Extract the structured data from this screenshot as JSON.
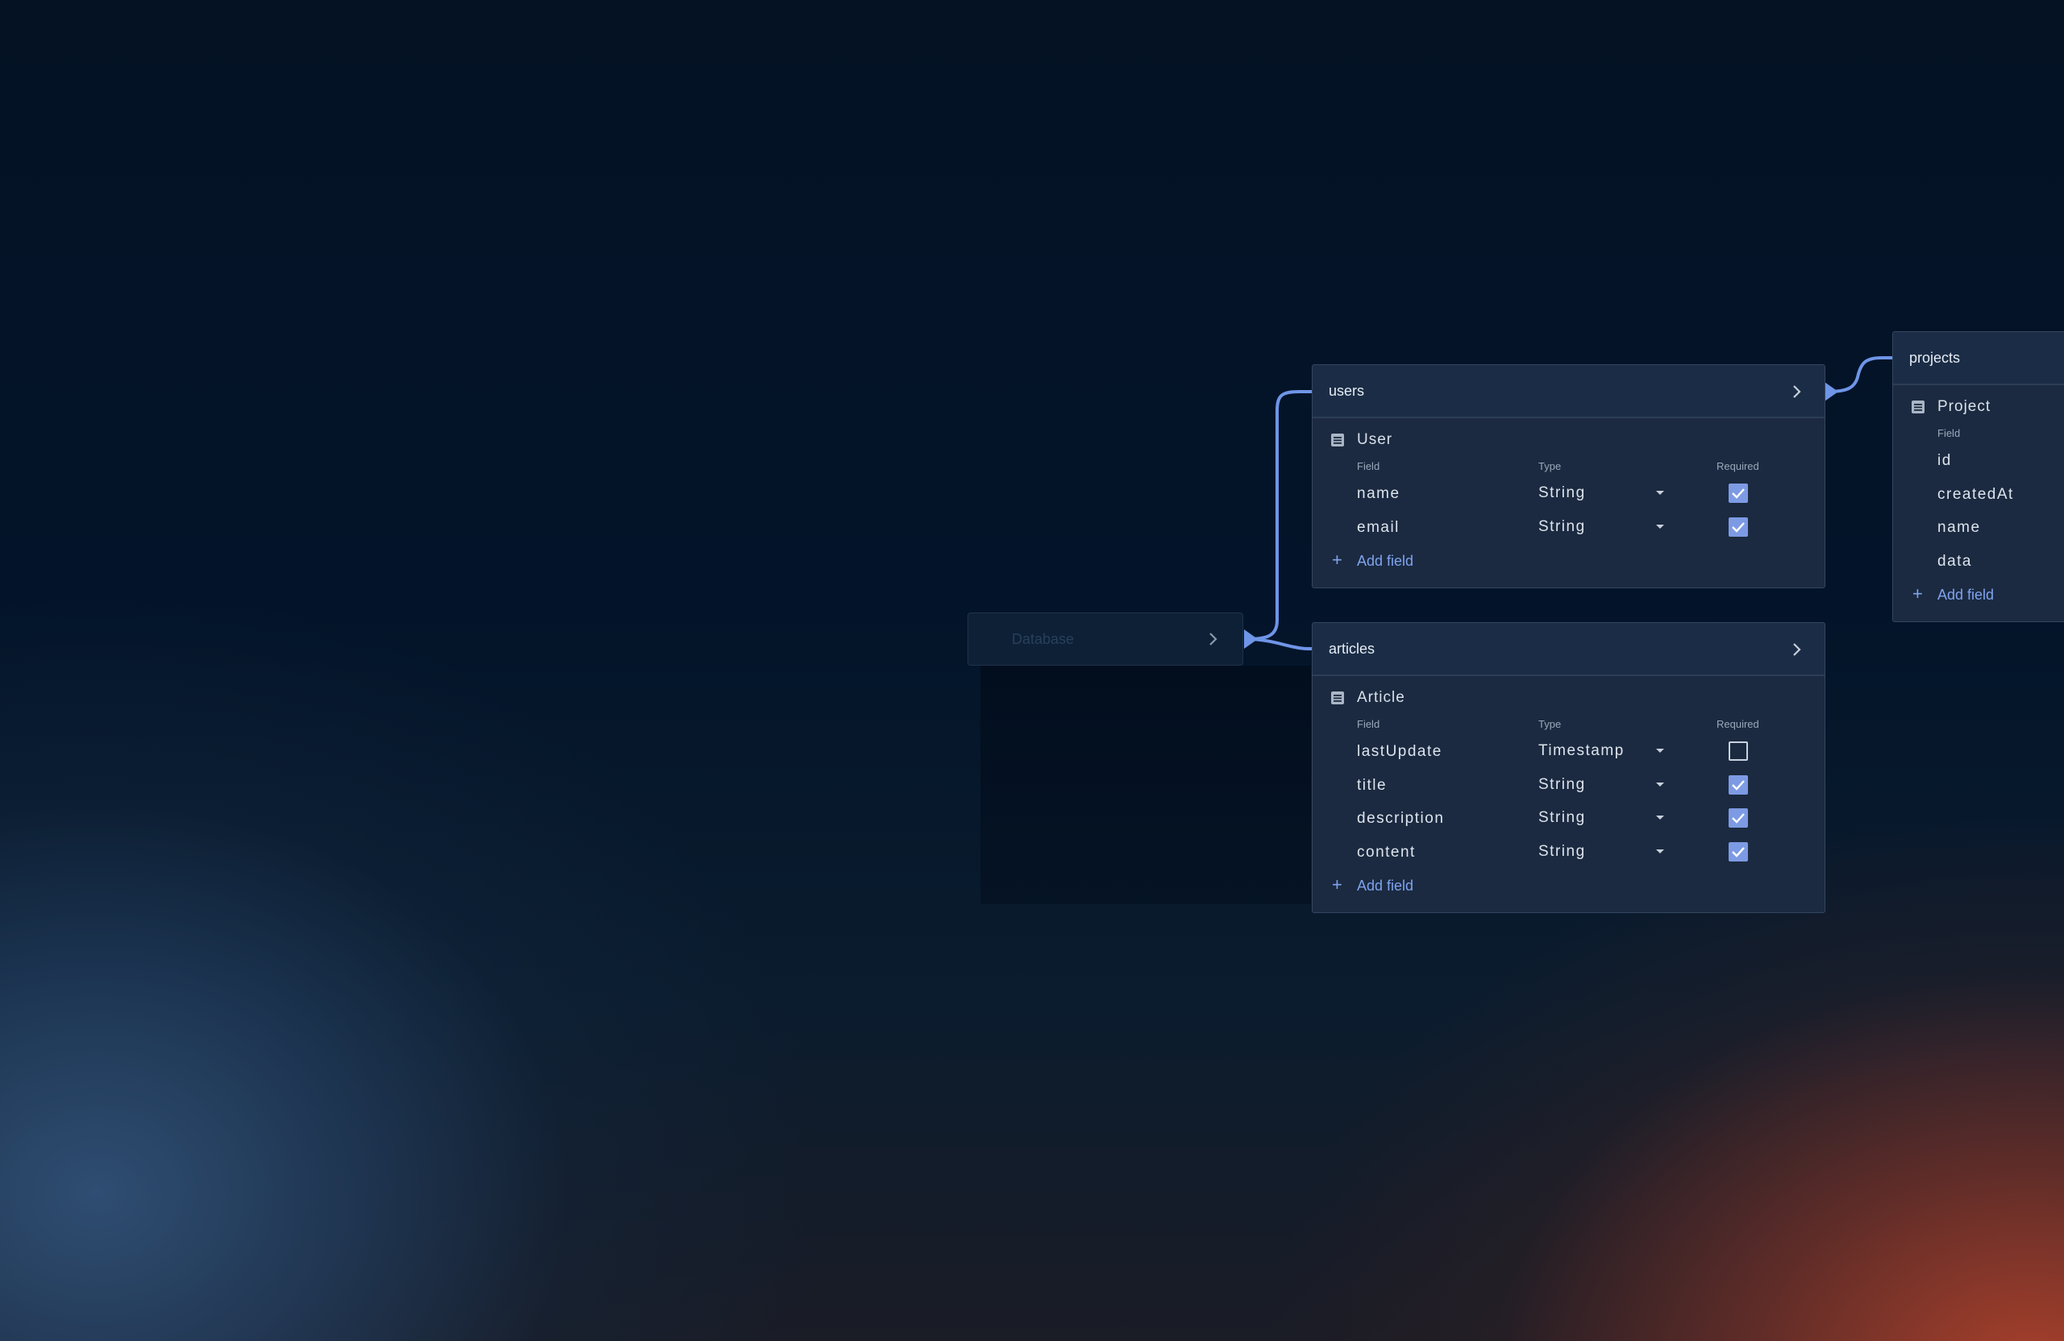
{
  "database_node": {
    "label": "Database"
  },
  "column_headers": {
    "field": "Field",
    "type": "Type",
    "required": "Required"
  },
  "add_field_label": "Add field",
  "plus_glyph": "+",
  "colors": {
    "accent": "#7fa3ee",
    "edge": "#6f95e8",
    "checkbox_on": "#7d9be4"
  },
  "icons": {
    "model": "table-icon",
    "open": "chevron-right-icon",
    "type_select": "caret-down-icon"
  },
  "tables": [
    {
      "title": "users",
      "model": "User",
      "fields": [
        {
          "name": "name",
          "type": "String",
          "required": true
        },
        {
          "name": "email",
          "type": "String",
          "required": true
        }
      ]
    },
    {
      "title": "articles",
      "model": "Article",
      "fields": [
        {
          "name": "lastUpdate",
          "type": "Timestamp",
          "required": false
        },
        {
          "name": "title",
          "type": "String",
          "required": true
        },
        {
          "name": "description",
          "type": "String",
          "required": true
        },
        {
          "name": "content",
          "type": "String",
          "required": true
        }
      ]
    },
    {
      "title": "projects",
      "model": "Project",
      "fields": [
        {
          "name": "id"
        },
        {
          "name": "createdAt"
        },
        {
          "name": "name"
        },
        {
          "name": "data"
        }
      ]
    }
  ]
}
